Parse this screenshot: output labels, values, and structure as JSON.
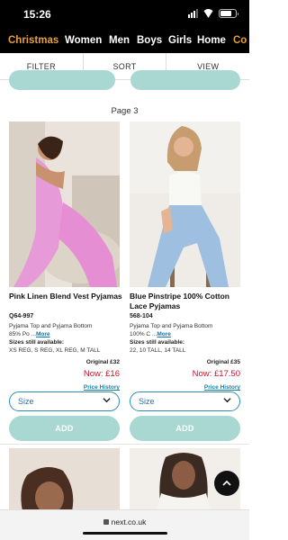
{
  "status": {
    "time": "15:26"
  },
  "nav": {
    "items": [
      "Christmas",
      "Women",
      "Men",
      "Boys",
      "Girls",
      "Home",
      "Co"
    ]
  },
  "filters": {
    "filter": "FILTER",
    "sort": "SORT",
    "view": "VIEW"
  },
  "page_label": "Page 3",
  "products": [
    {
      "title": "Pink Linen Blend Vest Pyjamas",
      "code": "Q64-997",
      "desc_line1": "Pyjama Top and Pyjama Bottom",
      "desc_line2": "85% Po ...",
      "more": "More",
      "sizes_label": "Sizes still available:",
      "sizes": "XS REG, S REG, XL REG, M TALL",
      "original": "Original £32",
      "now": "Now: £16",
      "history": "Price History",
      "select": "Size",
      "add": "ADD"
    },
    {
      "title": "Blue Pinstripe 100% Cotton Lace Pyjamas",
      "code": "568-104",
      "desc_line1": "Pyjama Top and Pyjama Bottom",
      "desc_line2": "100% C ...",
      "more": "More",
      "sizes_label": "Sizes still available:",
      "sizes": "22, 10 TALL, 14 TALL",
      "original": "Original £35",
      "now": "Now: £17.50",
      "history": "Price History",
      "select": "Size",
      "add": "ADD"
    }
  ],
  "url": "next.co.uk",
  "colors": {
    "accent": "#e5a13b",
    "price_red": "#d0112b",
    "add_bg": "#a9d8d2",
    "link": "#1a7f9c"
  }
}
